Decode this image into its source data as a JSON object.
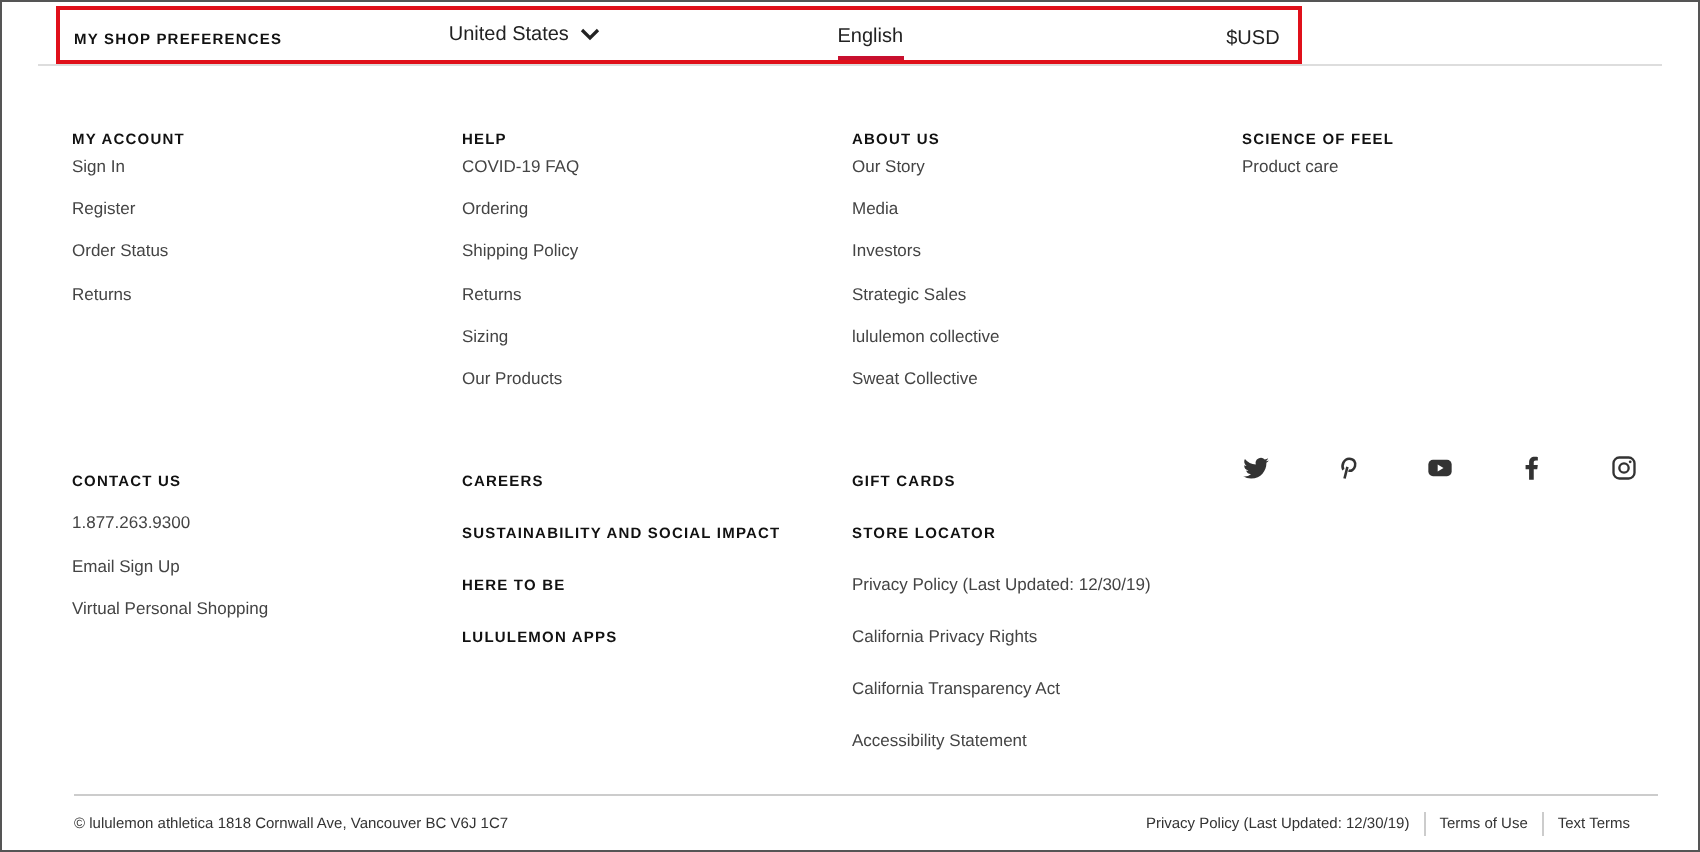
{
  "preferences": {
    "label": "MY SHOP PREFERENCES",
    "country": "United States",
    "language": {
      "label": "English",
      "selected": true
    },
    "currency": "$USD",
    "highlighted": true
  },
  "top_columns": [
    {
      "heading": "MY ACCOUNT",
      "links": [
        "Sign In",
        "Register",
        "Order Status",
        "Returns"
      ]
    },
    {
      "heading": "HELP",
      "links": [
        "COVID-19 FAQ",
        "Ordering",
        "Shipping Policy",
        "Returns",
        "Sizing",
        "Our Products"
      ]
    },
    {
      "heading": "ABOUT US",
      "links": [
        "Our Story",
        "Media",
        "Investors",
        "Strategic Sales",
        "lululemon collective",
        "Sweat Collective"
      ]
    },
    {
      "heading": "SCIENCE OF FEEL",
      "links": [
        "Product care"
      ]
    }
  ],
  "contact": {
    "heading": "CONTACT US",
    "links": [
      "1.877.263.9300",
      "Email Sign Up",
      "Virtual Personal Shopping"
    ]
  },
  "more_headings": [
    "CAREERS",
    "SUSTAINABILITY AND SOCIAL IMPACT",
    "HERE TO BE",
    "LULULEMON APPS"
  ],
  "store": {
    "headings": [
      "GIFT CARDS",
      "STORE LOCATOR"
    ],
    "links": [
      "Privacy Policy (Last Updated: 12/30/19)",
      "California Privacy Rights",
      "California Transparency Act",
      "Accessibility Statement"
    ]
  },
  "social": [
    {
      "kind": "twitter"
    },
    {
      "kind": "pinterest"
    },
    {
      "kind": "youtube"
    },
    {
      "kind": "facebook"
    },
    {
      "kind": "instagram"
    }
  ],
  "footer": {
    "copyright": "© lululemon athletica 1818 Cornwall Ave, Vancouver BC V6J 1C7",
    "links": [
      "Privacy Policy (Last Updated: 12/30/19)",
      "Terms of Use",
      "Text Terms"
    ]
  }
}
